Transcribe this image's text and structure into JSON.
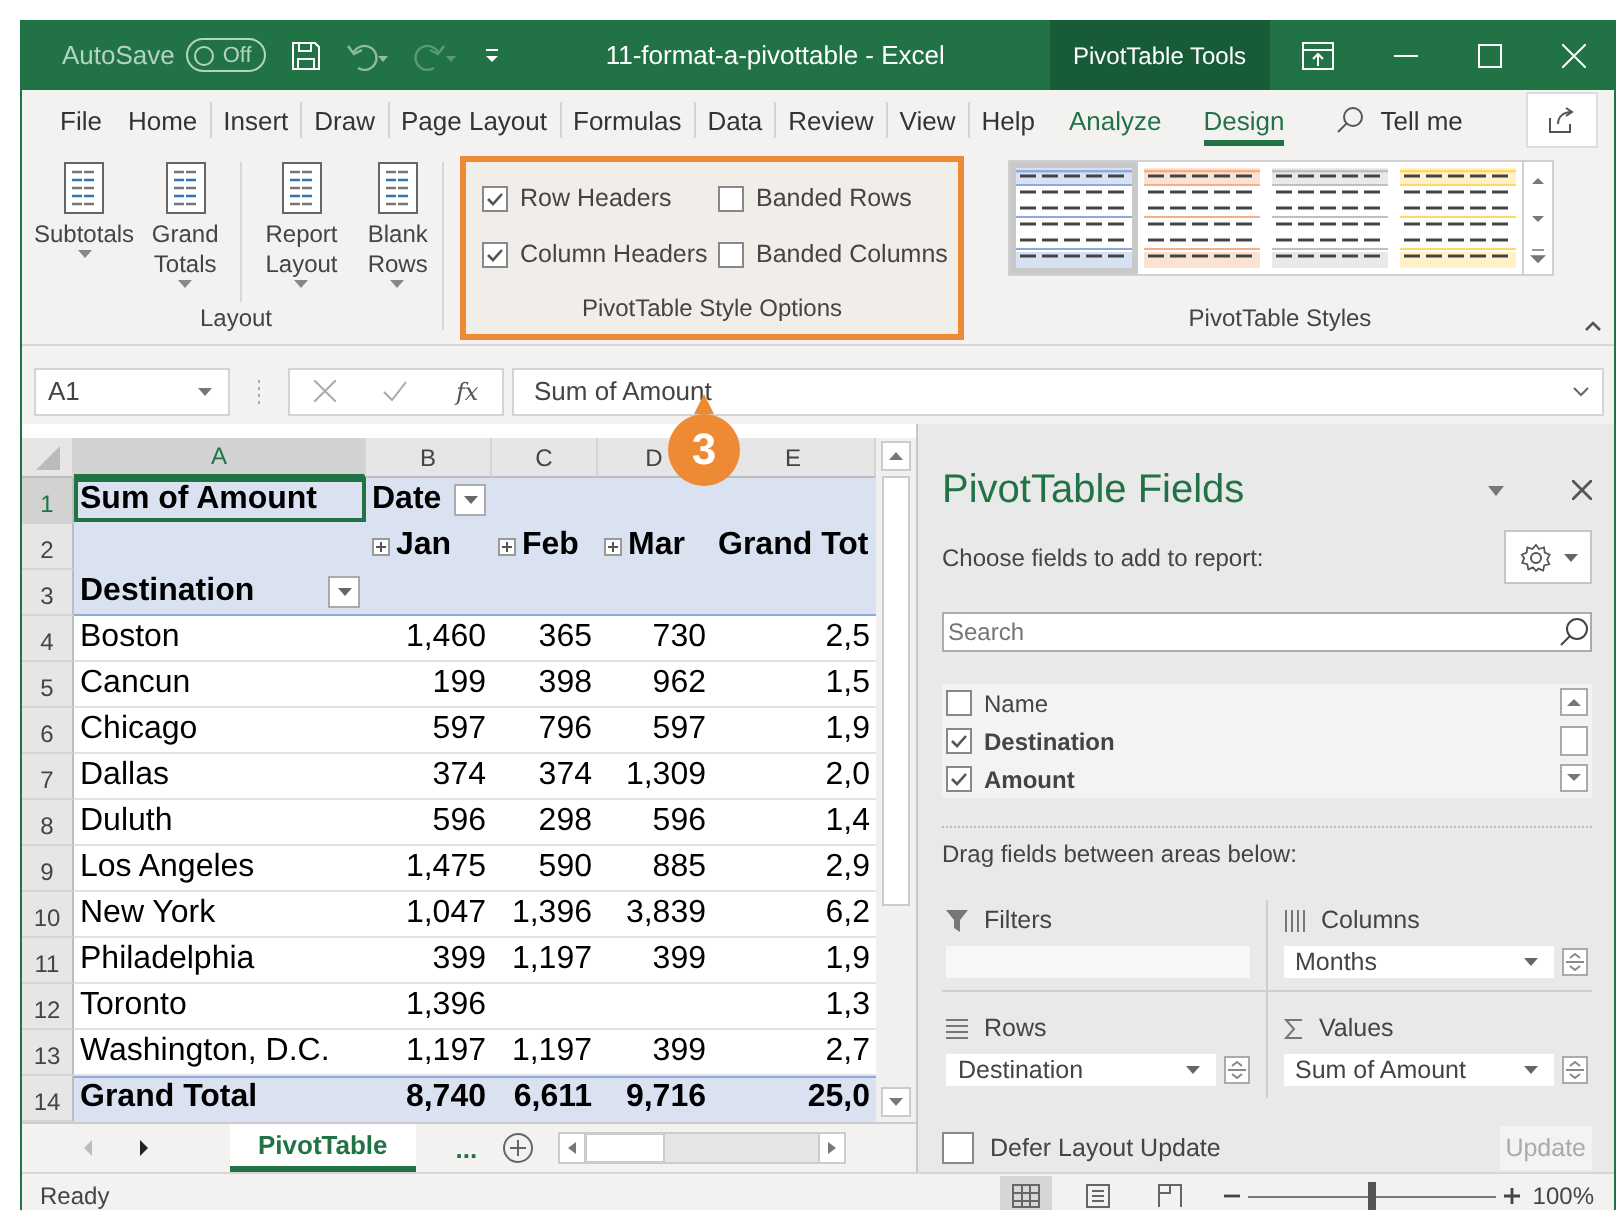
{
  "window": {
    "autosave_label": "AutoSave",
    "autosave_state": "Off",
    "title": "11-format-a-pivottable - Excel",
    "context_tab": "PivotTable Tools"
  },
  "tabs": [
    {
      "label": "File",
      "kind": "plain",
      "selected": false
    },
    {
      "label": "Home",
      "kind": "plain",
      "selected": false
    },
    {
      "label": "Insert",
      "kind": "plain",
      "selected": false
    },
    {
      "label": "Draw",
      "kind": "plain",
      "selected": false
    },
    {
      "label": "Page Layout",
      "kind": "plain",
      "selected": false
    },
    {
      "label": "Formulas",
      "kind": "plain",
      "selected": false
    },
    {
      "label": "Data",
      "kind": "plain",
      "selected": false
    },
    {
      "label": "Review",
      "kind": "plain",
      "selected": false
    },
    {
      "label": "View",
      "kind": "plain",
      "selected": false
    },
    {
      "label": "Help",
      "kind": "plain",
      "selected": false
    },
    {
      "label": "Analyze",
      "kind": "contextual",
      "selected": false
    },
    {
      "label": "Design",
      "kind": "contextual",
      "selected": true
    }
  ],
  "tell_me": "Tell me",
  "ribbon": {
    "layout_group": {
      "label": "Layout",
      "buttons": [
        {
          "label": "Subtotals"
        },
        {
          "label": "Grand Totals"
        },
        {
          "label": "Report Layout"
        },
        {
          "label": "Blank Rows"
        }
      ]
    },
    "style_options": {
      "label": "PivotTable Style Options",
      "highlighted": true,
      "options": [
        {
          "label": "Row Headers",
          "checked": true
        },
        {
          "label": "Banded Rows",
          "checked": false
        },
        {
          "label": "Column Headers",
          "checked": true
        },
        {
          "label": "Banded Columns",
          "checked": false
        }
      ]
    },
    "styles": {
      "label": "PivotTable Styles",
      "items": [
        {
          "color": "#8ea9db",
          "selected": true
        },
        {
          "color": "#f4b084",
          "selected": false
        },
        {
          "color": "#bfbfbf",
          "selected": false
        },
        {
          "color": "#ffd966",
          "selected": false
        }
      ]
    }
  },
  "callout": {
    "number": "3"
  },
  "formula_bar": {
    "name_box": "A1",
    "function_button": "fx",
    "formula": "Sum of Amount"
  },
  "grid": {
    "columns": [
      "A",
      "B",
      "C",
      "D",
      "E"
    ],
    "rows": [
      {
        "number": "1",
        "kind": "header",
        "cells": [
          {
            "text": "Sum of Amount",
            "selected": true
          },
          {
            "text": "Date",
            "kind": "filter"
          },
          null,
          null,
          null
        ]
      },
      {
        "number": "2",
        "kind": "header",
        "cells": [
          null,
          {
            "text": "Jan",
            "kind": "expand"
          },
          {
            "text": "Feb",
            "kind": "expand"
          },
          {
            "text": "Mar",
            "kind": "expand"
          },
          "Grand Tot"
        ]
      },
      {
        "number": "3",
        "kind": "header",
        "cells": [
          {
            "text": "Destination",
            "kind": "filter"
          },
          null,
          null,
          null,
          null
        ]
      },
      {
        "number": "4",
        "kind": "data",
        "cells": [
          "Boston",
          "1,460",
          "365",
          "730",
          "2,5"
        ]
      },
      {
        "number": "5",
        "kind": "data",
        "cells": [
          "Cancun",
          "199",
          "398",
          "962",
          "1,5"
        ]
      },
      {
        "number": "6",
        "kind": "data",
        "cells": [
          "Chicago",
          "597",
          "796",
          "597",
          "1,9"
        ]
      },
      {
        "number": "7",
        "kind": "data",
        "cells": [
          "Dallas",
          "374",
          "374",
          "1,309",
          "2,0"
        ]
      },
      {
        "number": "8",
        "kind": "data",
        "cells": [
          "Duluth",
          "596",
          "298",
          "596",
          "1,4"
        ]
      },
      {
        "number": "9",
        "kind": "data",
        "cells": [
          "Los Angeles",
          "1,475",
          "590",
          "885",
          "2,9"
        ]
      },
      {
        "number": "10",
        "kind": "data",
        "cells": [
          "New York",
          "1,047",
          "1,396",
          "3,839",
          "6,2"
        ]
      },
      {
        "number": "11",
        "kind": "data",
        "cells": [
          "Philadelphia",
          "399",
          "1,197",
          "399",
          "1,9"
        ]
      },
      {
        "number": "12",
        "kind": "data",
        "cells": [
          "Toronto",
          "1,396",
          null,
          null,
          "1,3"
        ]
      },
      {
        "number": "13",
        "kind": "data",
        "cells": [
          "Washington, D.C.",
          "1,197",
          "1,197",
          "399",
          "2,7"
        ]
      },
      {
        "number": "14",
        "kind": "total",
        "cells": [
          "Grand Total",
          "8,740",
          "6,611",
          "9,716",
          "25,0"
        ]
      }
    ]
  },
  "sheet_tabs": {
    "tabs": [
      {
        "label": "PivotTable",
        "selected": true
      }
    ],
    "more": "..."
  },
  "field_pane": {
    "title": "PivotTable Fields",
    "prompt": "Choose fields to add to report:",
    "search": {
      "placeholder": "Search"
    },
    "fields": [
      {
        "label": "Name",
        "checked": false
      },
      {
        "label": "Destination",
        "checked": true
      },
      {
        "label": "Amount",
        "checked": true
      }
    ],
    "drag_hint": "Drag fields between areas below:",
    "areas": [
      {
        "kind": "filters",
        "label": "Filters"
      },
      {
        "kind": "columns",
        "label": "Columns",
        "field": "Months"
      },
      {
        "kind": "rows",
        "label": "Rows",
        "field": "Destination"
      },
      {
        "kind": "values",
        "label": "Values",
        "field": "Sum of Amount"
      }
    ],
    "defer": {
      "label": "Defer Layout Update",
      "checked": false
    },
    "update_button": {
      "label": "Update",
      "disabled": true
    }
  },
  "status_bar": {
    "status": "Ready",
    "views": [
      {
        "kind": "normal",
        "selected": true
      },
      {
        "kind": "page-layout",
        "selected": false
      },
      {
        "kind": "page-break",
        "selected": false
      }
    ],
    "zoom": {
      "level": 0.5,
      "reading": "100%"
    }
  }
}
